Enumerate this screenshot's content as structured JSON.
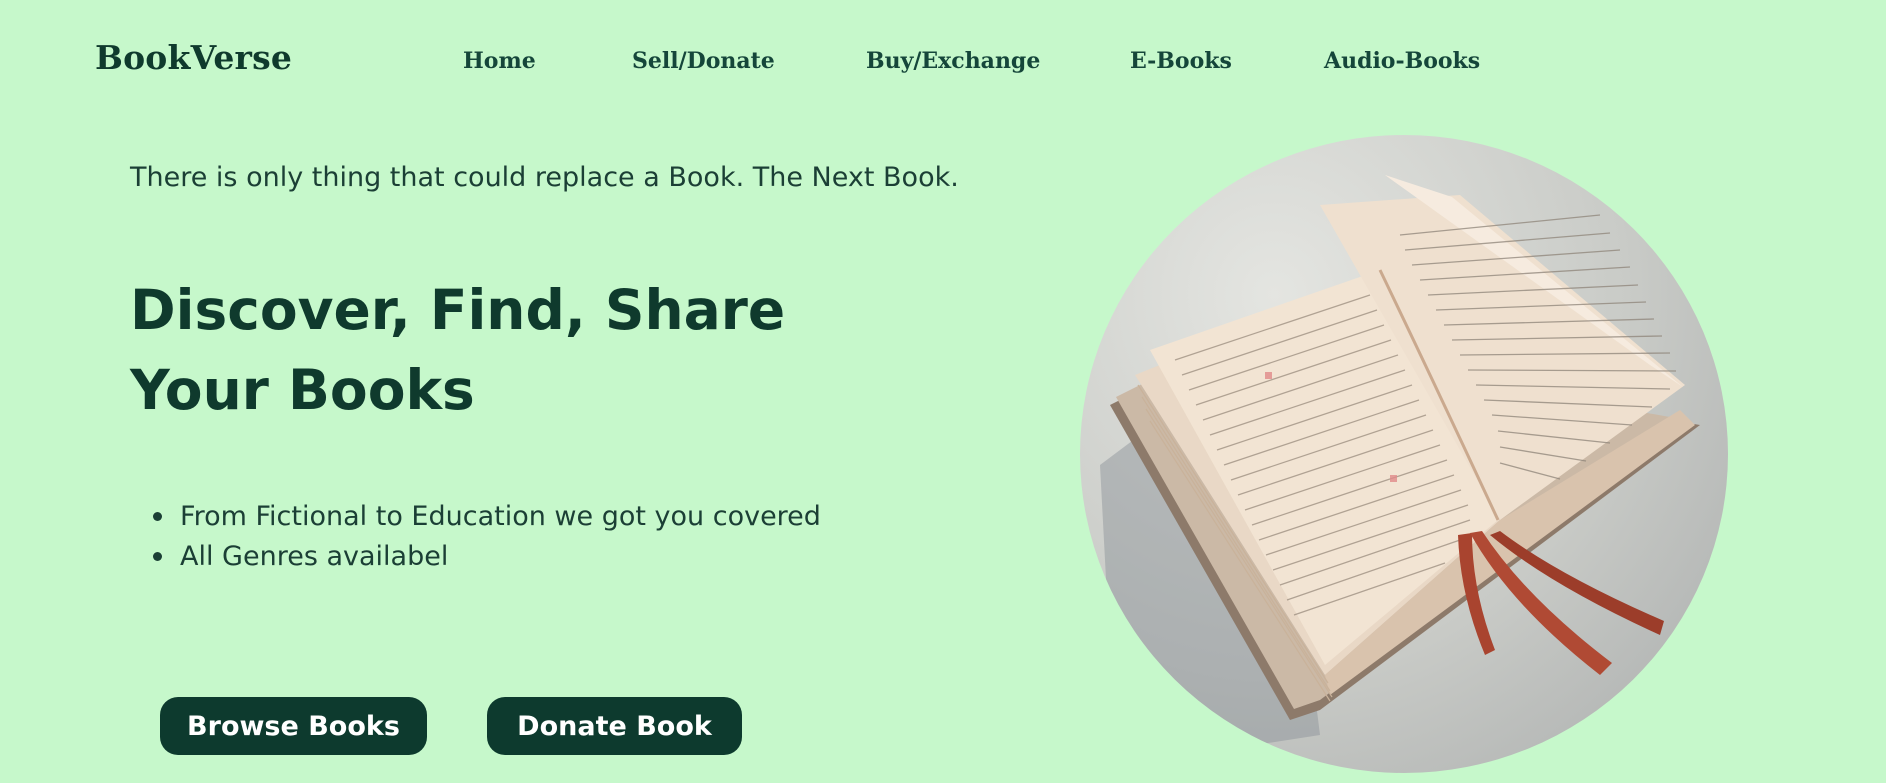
{
  "brand": {
    "logo": "BookVerse"
  },
  "nav": {
    "items": [
      {
        "label": "Home"
      },
      {
        "label": "Sell/Donate"
      },
      {
        "label": "Buy/Exchange"
      },
      {
        "label": "E-Books"
      },
      {
        "label": "Audio-Books"
      }
    ]
  },
  "hero": {
    "tagline": "There is only thing that could replace a Book. The Next Book.",
    "headline_line1": "Discover, Find, Share",
    "headline_line2": "Your Books",
    "features": [
      "From Fictional to Education we got you covered",
      "All Genres availabel"
    ],
    "buttons": {
      "browse": "Browse Books",
      "donate": "Donate Book"
    },
    "image": {
      "icon": "open-book-illustration"
    }
  },
  "colors": {
    "background": "#c6f8cb",
    "primary": "#0f3a2d",
    "button": "#0d3a2e",
    "button_text": "#ffffff"
  }
}
